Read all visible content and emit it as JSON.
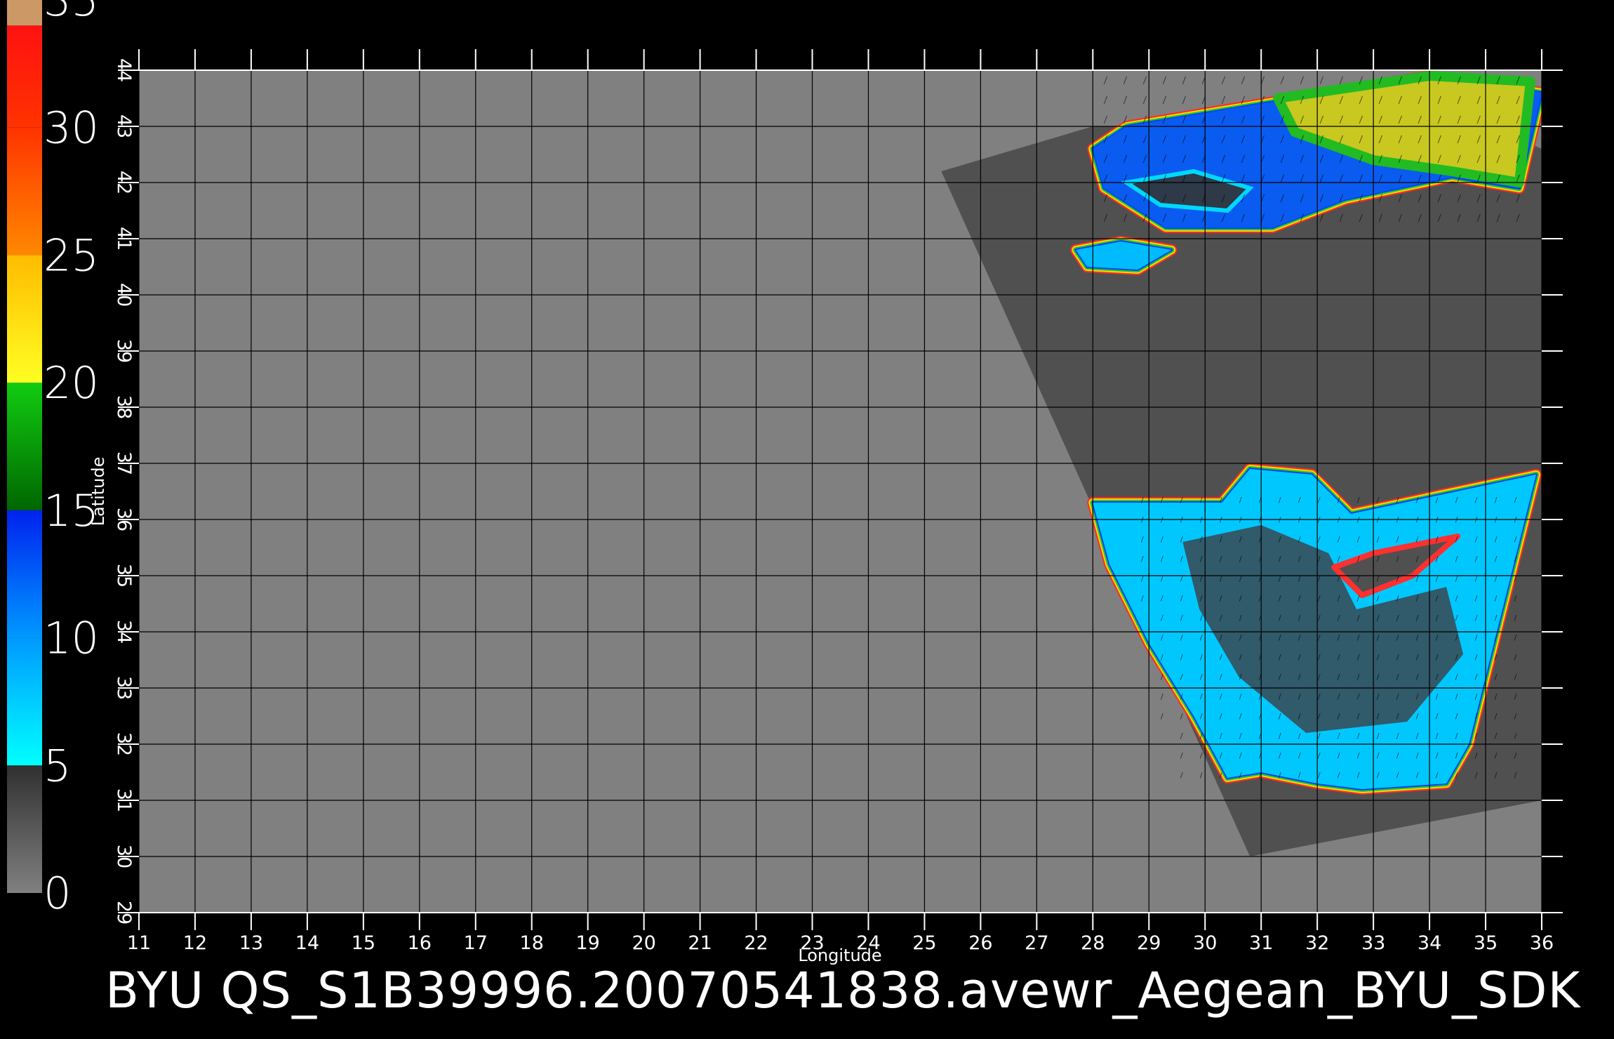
{
  "map": {
    "x_axis": {
      "label": "Longitude",
      "min": 11,
      "max": 36,
      "ticks": [
        11,
        12,
        13,
        14,
        15,
        16,
        17,
        18,
        19,
        20,
        21,
        22,
        23,
        24,
        25,
        26,
        27,
        28,
        29,
        30,
        31,
        32,
        33,
        34,
        35,
        36
      ]
    },
    "y_axis": {
      "label": "Latitude",
      "min": 29,
      "max": 44,
      "ticks": [
        29,
        30,
        31,
        32,
        33,
        34,
        35,
        36,
        37,
        38,
        39,
        40,
        41,
        42,
        43,
        44
      ]
    },
    "grid": true,
    "background_color": "#808080",
    "swath_color": "#505050",
    "swath_corners_lonlat": [
      [
        25.3,
        42.2
      ],
      [
        28.0,
        43.0
      ],
      [
        35.1,
        43.0
      ],
      [
        36.0,
        42.6
      ],
      [
        36.0,
        31.0
      ],
      [
        30.8,
        30.0
      ]
    ],
    "caption": "BYU  QS_S1B39996.20070541838.avewr_Aegean_BYU_SDK"
  },
  "colorbar": {
    "labels": [
      "35",
      "30",
      "25",
      "20",
      "15",
      "10",
      "5",
      "0"
    ],
    "min": 0,
    "max": 35,
    "segments": [
      {
        "from": 0,
        "to": 5,
        "colors": [
          "#808080",
          "#303030"
        ]
      },
      {
        "from": 5,
        "to": 10,
        "colors": [
          "#00ffff",
          "#0099ff"
        ]
      },
      {
        "from": 10,
        "to": 15,
        "colors": [
          "#0099ff",
          "#0022ee"
        ]
      },
      {
        "from": 15,
        "to": 20,
        "colors": [
          "#006600",
          "#11cc11"
        ]
      },
      {
        "from": 20,
        "to": 25,
        "colors": [
          "#ffff22",
          "#ffbb00"
        ]
      },
      {
        "from": 25,
        "to": 30,
        "colors": [
          "#ff8800",
          "#ff3300"
        ]
      },
      {
        "from": 30,
        "to": 34,
        "colors": [
          "#ff3300",
          "#ff1111"
        ]
      },
      {
        "from": 34,
        "to": 35,
        "colors": [
          "#cc9966",
          "#cc9966"
        ]
      }
    ]
  },
  "wind_regions": {
    "black_sea": [
      [
        28.0,
        42.6
      ],
      [
        28.6,
        43.0
      ],
      [
        34.0,
        43.9
      ],
      [
        36.0,
        43.6
      ],
      [
        35.6,
        41.9
      ],
      [
        34.4,
        42.1
      ],
      [
        32.5,
        41.7
      ],
      [
        31.2,
        41.2
      ],
      [
        29.3,
        41.2
      ],
      [
        28.2,
        41.9
      ]
    ],
    "black_sea_calm": [
      [
        28.6,
        42.0
      ],
      [
        29.8,
        42.2
      ],
      [
        30.8,
        41.9
      ],
      [
        30.4,
        41.5
      ],
      [
        29.2,
        41.6
      ]
    ],
    "black_sea_strong": [
      [
        31.3,
        43.5
      ],
      [
        34.0,
        43.9
      ],
      [
        35.8,
        43.8
      ],
      [
        35.6,
        42.0
      ],
      [
        34.4,
        42.2
      ],
      [
        33.0,
        42.4
      ],
      [
        31.6,
        42.9
      ]
    ],
    "marmara": [
      [
        27.7,
        40.8
      ],
      [
        28.5,
        40.95
      ],
      [
        29.4,
        40.8
      ],
      [
        28.8,
        40.45
      ],
      [
        27.9,
        40.5
      ]
    ],
    "levant": [
      [
        28.0,
        36.3
      ],
      [
        30.3,
        36.3
      ],
      [
        30.8,
        36.9
      ],
      [
        31.9,
        36.8
      ],
      [
        32.6,
        36.1
      ],
      [
        35.9,
        36.8
      ],
      [
        35.6,
        35.6
      ],
      [
        35.2,
        34.0
      ],
      [
        34.7,
        32.0
      ],
      [
        34.3,
        31.3
      ],
      [
        32.8,
        31.2
      ],
      [
        32.0,
        31.3
      ],
      [
        31.0,
        31.5
      ],
      [
        30.4,
        31.4
      ],
      [
        29.8,
        32.5
      ],
      [
        29.0,
        33.8
      ],
      [
        28.3,
        35.2
      ]
    ],
    "cyprus": [
      [
        32.3,
        35.15
      ],
      [
        33.0,
        35.4
      ],
      [
        34.5,
        35.7
      ],
      [
        33.7,
        35.0
      ],
      [
        32.8,
        34.65
      ]
    ]
  }
}
